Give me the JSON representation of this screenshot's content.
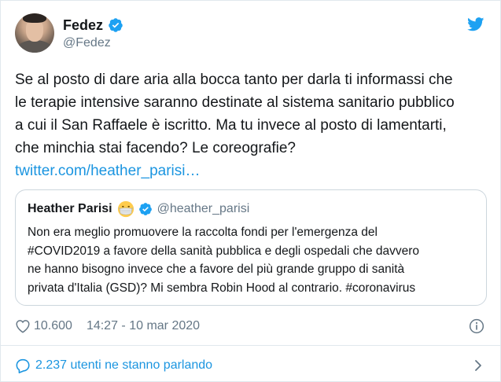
{
  "author": {
    "name": "Fedez",
    "handle": "@Fedez"
  },
  "tweet": {
    "lines": [
      "Se al posto di dare aria alla bocca tanto per darla ti informassi che",
      "le terapie intensive saranno destinate al sistema sanitario pubblico",
      "a cui il San Raffaele è iscritto. Ma tu invece al posto di lamentarti,",
      "che minchia stai facendo? Le coreografie?"
    ],
    "link": "twitter.com/heather_parisi…"
  },
  "quoted": {
    "name": "Heather Parisi",
    "handle": "@heather_parisi",
    "lines": [
      "Non era meglio promuovere la raccolta fondi per l'emergenza del",
      "#COVID2019 a favore della sanità pubblica e degli ospedali che davvero",
      "ne hanno bisogno invece che a favore del più grande gruppo di sanità",
      "privata d'Italia (GSD)? Mi sembra Robin Hood al contrario. #coronavirus"
    ]
  },
  "meta": {
    "likes": "10.600",
    "timestamp": "14:27 - 10 mar 2020"
  },
  "footer": {
    "conversation": "2.237 utenti ne stanno parlando"
  },
  "colors": {
    "brand": "#1da1f2",
    "link": "#1b95e0",
    "muted": "#657786",
    "text": "#14171a"
  },
  "icons": [
    "twitter-bird-icon",
    "verified-badge-icon",
    "face-with-mask-emoji",
    "heart-icon",
    "info-icon",
    "chat-bubble-icon",
    "chevron-right-icon"
  ]
}
